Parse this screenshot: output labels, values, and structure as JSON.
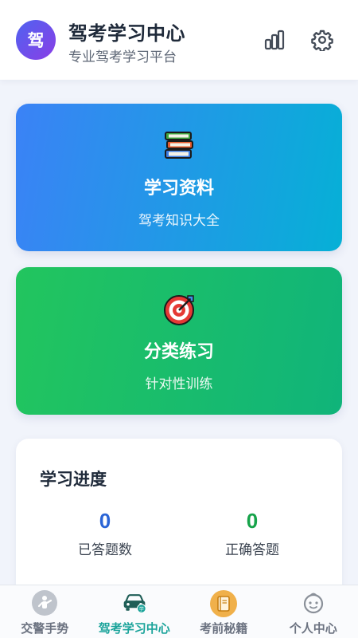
{
  "header": {
    "logo_char": "驾",
    "title": "驾考学习中心",
    "subtitle": "专业驾考学习平台",
    "stats_icon": "bar-chart-icon",
    "settings_icon": "gear-icon"
  },
  "cards": [
    {
      "title": "学习资料",
      "subtitle": "驾考知识大全",
      "icon": "books-icon",
      "gradient": [
        "#3b82f6",
        "#06b0d6"
      ]
    },
    {
      "title": "分类练习",
      "subtitle": "针对性训练",
      "icon": "target-icon",
      "gradient": [
        "#22c55e",
        "#10b47a"
      ]
    }
  ],
  "progress": {
    "title": "学习进度",
    "stats": [
      {
        "value": "0",
        "label": "已答题数",
        "color": "#2a64d6"
      },
      {
        "value": "0",
        "label": "正确答题",
        "color": "#16a34a"
      },
      {
        "value": "",
        "label": "",
        "color": "#dc2626"
      },
      {
        "value": "",
        "label": "",
        "color": "#7c3aed"
      }
    ]
  },
  "nav": {
    "items": [
      {
        "label": "交警手势",
        "icon": "traffic-police-icon",
        "active": false
      },
      {
        "label": "驾考学习中心",
        "icon": "car-study-icon",
        "active": true
      },
      {
        "label": "考前秘籍",
        "icon": "book-icon",
        "active": false
      },
      {
        "label": "个人中心",
        "icon": "profile-face-icon",
        "active": false
      }
    ],
    "active_color": "#1aa39a"
  }
}
